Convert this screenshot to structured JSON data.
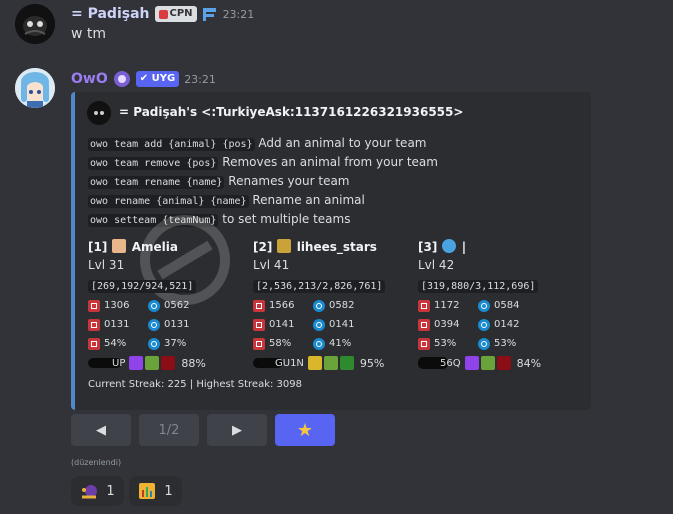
{
  "message1": {
    "username": "= Padişah",
    "badge": "CPN",
    "time": "23:21",
    "text": "w tm"
  },
  "message2": {
    "username": "OwO",
    "bot_badge": "✔ UYG",
    "time": "23:21"
  },
  "embed": {
    "author": "= Padişah's <:TurkiyeAsk:1137161226321936555>",
    "commands": [
      {
        "code": "owo team add {animal} {pos}",
        "desc": "Add an animal to your team"
      },
      {
        "code": "owo team remove {pos}",
        "desc": "Removes an animal from your team"
      },
      {
        "code": "owo team rename {name}",
        "desc": "Renames your team"
      },
      {
        "code": "owo rename {animal} {name}",
        "desc": "Rename an animal"
      },
      {
        "code": "owo setteam {teamNum}",
        "desc": "to set multiple teams"
      }
    ],
    "team": [
      {
        "slot": "[1]",
        "name": "Amelia",
        "lvl": "Lvl 31",
        "xp": "[269,192/924,521]",
        "hp": "1306",
        "wp": "0562",
        "att": "0131",
        "mag": "0131",
        "pr": "54%",
        "mr": "37%",
        "code": "UP",
        "pct": "88%"
      },
      {
        "slot": "[2]",
        "name": "lihees_stars",
        "lvl": "Lvl 41",
        "xp": "[2,536,213/2,826,761]",
        "hp": "1566",
        "wp": "0582",
        "att": "0141",
        "mag": "0141",
        "pr": "58%",
        "mr": "41%",
        "code": "GU1N",
        "pct": "95%"
      },
      {
        "slot": "[3]",
        "name": "|",
        "lvl": "Lvl 42",
        "xp": "[319,880/3,112,696]",
        "hp": "1172",
        "wp": "0584",
        "att": "0394",
        "mag": "0142",
        "pr": "53%",
        "mr": "53%",
        "code": "56Q",
        "pct": "84%"
      }
    ],
    "streak": "Current Streak: 225 | Highest Streak: 3098"
  },
  "buttons": {
    "prev": "◀",
    "page": "1/2",
    "next": "▶",
    "star": "★"
  },
  "edited": "(düzenlendi)",
  "reactions": [
    {
      "count": "1"
    },
    {
      "count": "1"
    }
  ],
  "colors": {
    "accent": "#5865f2",
    "embed_border": "#4e8bc6",
    "owo_name": "#9b7cf2"
  }
}
